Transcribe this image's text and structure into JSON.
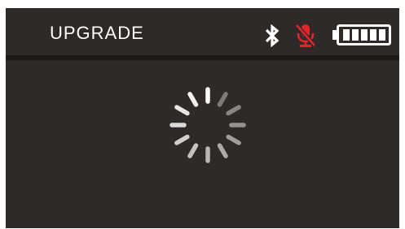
{
  "header": {
    "title": "UPGRADE"
  },
  "status": {
    "bluetooth": {
      "icon": "bluetooth-icon",
      "color": "#ffffff"
    },
    "microphone": {
      "icon": "mic-muted-icon",
      "state": "muted",
      "color": "#e0262b"
    },
    "battery": {
      "icon": "battery-icon",
      "level_bars": 5,
      "max_bars": 5,
      "color": "#ffffff"
    }
  },
  "main": {
    "spinner": {
      "icon": "loading-spinner-icon",
      "segments": 12
    }
  },
  "colors": {
    "screen_background": "#2f2a27",
    "divider": "#1c1917",
    "text": "#ffffff",
    "accent_red": "#e0262b"
  }
}
